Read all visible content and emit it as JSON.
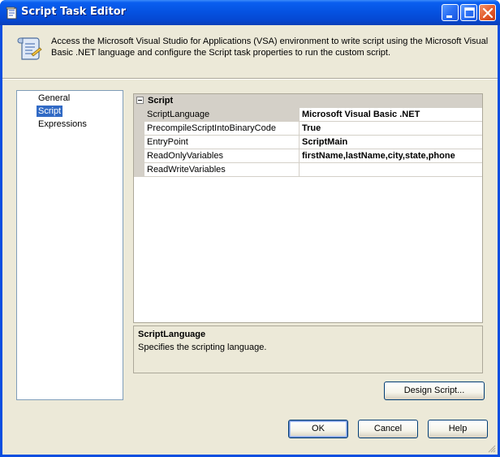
{
  "window": {
    "title": "Script Task Editor",
    "icon": "script-task-icon"
  },
  "titlebar_buttons": {
    "minimize_icon": "minimize-icon",
    "maximize_icon": "maximize-icon",
    "close_icon": "close-icon"
  },
  "header": {
    "icon": "scroll-icon",
    "description": "Access the Microsoft Visual Studio for Applications (VSA) environment to write script using the Microsoft Visual Basic .NET language and configure the Script task properties to run the custom script."
  },
  "nav": {
    "items": [
      {
        "label": "General"
      },
      {
        "label": "Script"
      },
      {
        "label": "Expressions"
      }
    ],
    "selected": "Script"
  },
  "grid": {
    "category": "Script",
    "properties": [
      {
        "name": "ScriptLanguage",
        "value": "Microsoft Visual Basic .NET"
      },
      {
        "name": "PrecompileScriptIntoBinaryCode",
        "value": "True"
      },
      {
        "name": "EntryPoint",
        "value": "ScriptMain"
      },
      {
        "name": "ReadOnlyVariables",
        "value": "firstName,lastName,city,state,phone"
      },
      {
        "name": "ReadWriteVariables",
        "value": ""
      }
    ]
  },
  "description_panel": {
    "title": "ScriptLanguage",
    "text": "Specifies the scripting language."
  },
  "buttons": {
    "design_script": "Design Script...",
    "ok": "OK",
    "cancel": "Cancel",
    "help": "Help"
  },
  "colors": {
    "titlebar": "#0553e2",
    "selection": "#316ac5",
    "face": "#ece9d8"
  }
}
